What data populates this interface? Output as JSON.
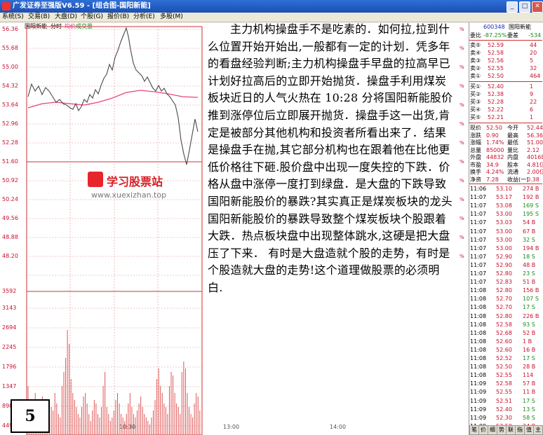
{
  "window": {
    "title": "广发证券至强版V6.59 - [组合图-国阳新能]",
    "btn_min": "_",
    "btn_max": "□",
    "btn_close": "✕"
  },
  "menu": [
    "系统(S)",
    "交易(B)",
    "大盘(D)",
    "个股(G)",
    "报价(B)",
    "分析(E)",
    "多股(M)"
  ],
  "chart": {
    "stock_name": "国阳新能",
    "label_fen": "分时",
    "label_avg": "均价",
    "label_vol": "成交量",
    "price_ticks": [
      "56.36",
      "55.68",
      "55.00",
      "54.32",
      "53.64",
      "52.96",
      "52.28",
      "51.60",
      "50.92",
      "50.24",
      "49.56",
      "48.88",
      "48.20"
    ],
    "volume_ticks": [
      "3592",
      "3143",
      "2694",
      "2245",
      "1796",
      "1347",
      "898",
      "449"
    ],
    "pct_labels": [
      "%",
      "%",
      "%",
      "%",
      "%",
      "%",
      "%",
      "%",
      "%",
      "%",
      "%",
      "%",
      "%"
    ],
    "x_labels": [
      "10:30",
      "13:00",
      "14:00"
    ],
    "colors": {
      "price_line": "#4a4a4a",
      "avg_line": "#e8457a",
      "volume": "#e05555",
      "grid": "#d02020"
    }
  },
  "watermark": {
    "text": "学习股票站",
    "url": "www.xuexizhan.top"
  },
  "figure_number": "5",
  "article": "主力机构操盘手不是吃素的．如何拉,拉到什么位置开始开始出,一般都有一定的计划．凭多年的看盘经验判断;主力机构操盘手早盘的拉高早已计划好拉高后的立即开始抛货．操盘手利用煤炭板块近日的人气火热在 10:28 分将国阳新能股价推到涨停位后立即展开抛货．操盘手这一出货,肯定是被部分其他机构和投资者所看出来了．结果是操盘手在抛,其它部分机构也在跟着他在比他更低价格往下砸.股价盘中出现一度失控的下跌．价格从盘中涨停一度打到绿盘．是大盘的下跌导致国阳新能股价的暴跌?其实真正是煤炭板块的龙头国阳新能股价的暴跌导致整个煤炭板块个股跟着大跌．热点板块盘中出现整体跳水,这硬是把大盘压了下来．  有时是大盘造就个股的走势，有时是个股造就大盘的走势!这个道理做股票的必须明白.",
  "panel": {
    "code": "600348",
    "name": "国阳新能",
    "weibi_label": "委比",
    "weibi": "-87.25%",
    "weicha_label": "委差",
    "weicha": "-534",
    "asks": [
      [
        "卖⑤",
        "52.59",
        "44"
      ],
      [
        "卖④",
        "52.58",
        "20"
      ],
      [
        "卖③",
        "52.56",
        "5"
      ],
      [
        "卖②",
        "52.55",
        "32"
      ],
      [
        "卖①",
        "52.50",
        "464"
      ]
    ],
    "bids": [
      [
        "买①",
        "52.40",
        "1"
      ],
      [
        "买②",
        "52.38",
        "9"
      ],
      [
        "买③",
        "52.28",
        "22"
      ],
      [
        "买④",
        "52.22",
        "6"
      ],
      [
        "买⑤",
        "52.21",
        "1"
      ]
    ],
    "quote": [
      [
        "现价",
        "52.50",
        "今开",
        "52.44"
      ],
      [
        "涨跌",
        "0.90",
        "最高",
        "56.36"
      ],
      [
        "涨幅",
        "1.74%",
        "最低",
        "51.00"
      ],
      [
        "总量",
        "85000",
        "量比",
        "2.12"
      ],
      [
        "外盘",
        "44832",
        "内盘",
        "40168"
      ],
      [
        "市盈",
        "34.9",
        "股本",
        "4.81亿"
      ],
      [
        "换手",
        "4.24%",
        "流通",
        "2.00亿"
      ],
      [
        "净资",
        "7.28",
        "收益(一)",
        "0.38"
      ]
    ],
    "ticks": [
      [
        "11:06",
        "53.10",
        "274 B"
      ],
      [
        "11:07",
        "53.17",
        "192 B"
      ],
      [
        "11:07",
        "53.08",
        "169 S"
      ],
      [
        "11:07",
        "53.00",
        "195 S"
      ],
      [
        "11:07",
        "53.03",
        "54 B"
      ],
      [
        "11:07",
        "53.00",
        "67 B"
      ],
      [
        "11:07",
        "53.00",
        "32 S"
      ],
      [
        "11:07",
        "53.00",
        "194 B"
      ],
      [
        "11:07",
        "52.90",
        "18 S"
      ],
      [
        "11:07",
        "52.90",
        "48 B"
      ],
      [
        "11:07",
        "52.80",
        "23 S"
      ],
      [
        "11:07",
        "52.83",
        "51 B"
      ],
      [
        "11:08",
        "52.80",
        "156 B"
      ],
      [
        "11:08",
        "52.70",
        "107 S"
      ],
      [
        "11:08",
        "52.70",
        "17 S"
      ],
      [
        "11:08",
        "52.80",
        "226 B"
      ],
      [
        "11:08",
        "52.58",
        "93 S"
      ],
      [
        "11:08",
        "52.68",
        "52 B"
      ],
      [
        "11:08",
        "52.60",
        "1 B"
      ],
      [
        "11:08",
        "52.60",
        "16 B"
      ],
      [
        "11:08",
        "52.52",
        "17 S"
      ],
      [
        "11:08",
        "52.50",
        "28 B"
      ],
      [
        "11:08",
        "52.55",
        "114"
      ],
      [
        "11:09",
        "52.58",
        "57 B"
      ],
      [
        "11:09",
        "52.55",
        "11 B"
      ],
      [
        "11:09",
        "52.51",
        "17 S"
      ],
      [
        "11:09",
        "52.40",
        "13 S"
      ],
      [
        "11:09",
        "52.30",
        "58 S"
      ],
      [
        "11:09",
        "52.50",
        "24 B"
      ]
    ],
    "tabs": [
      "笔",
      "价",
      "细",
      "势",
      "联",
      "指",
      "值",
      "主"
    ]
  }
}
